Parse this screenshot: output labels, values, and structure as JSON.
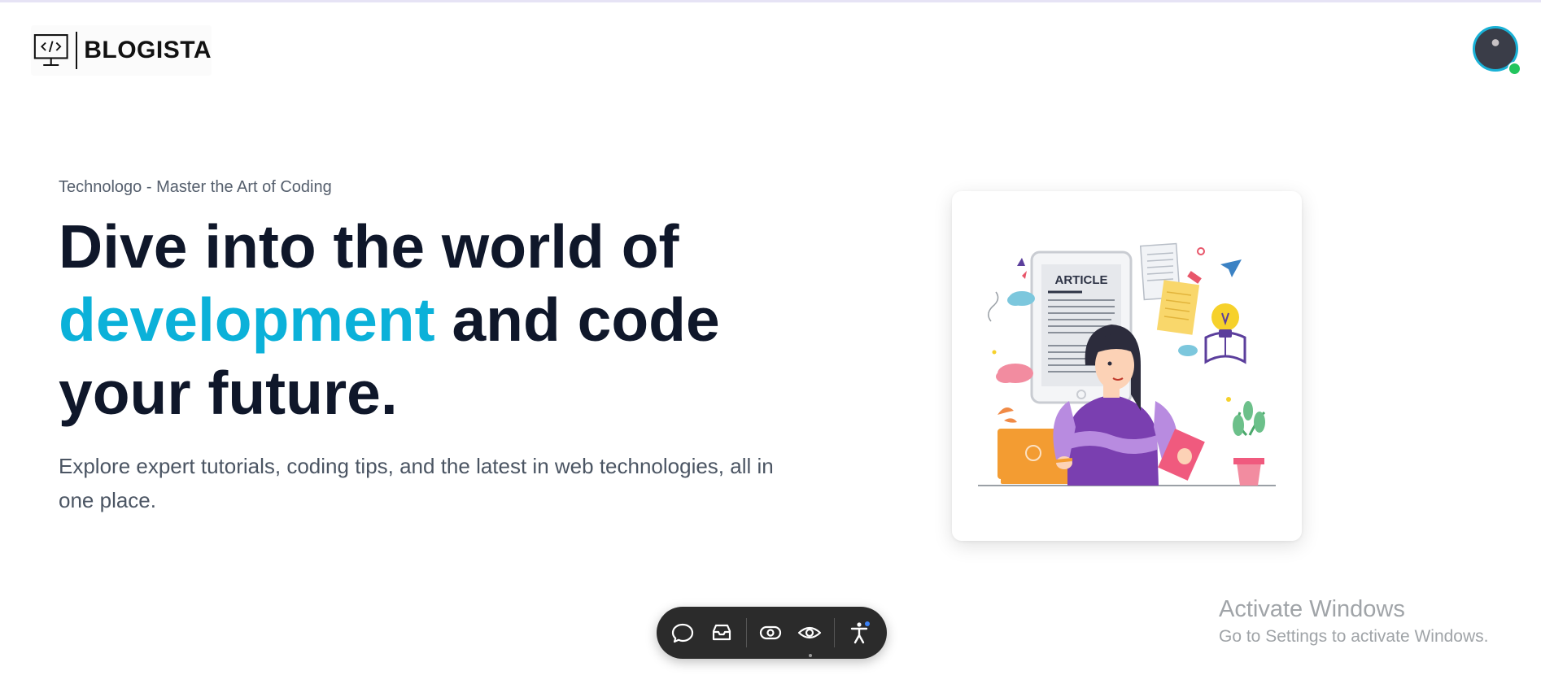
{
  "header": {
    "logo_text": "BLOGISTA",
    "logo_icon": "monitor-code-icon",
    "avatar": "user-avatar",
    "status_color": "#22c55e"
  },
  "hero": {
    "eyebrow": "Technologo - Master the Art of Coding",
    "headline_part1": "Dive into the world of",
    "headline_accent": "development",
    "headline_part2": "and code",
    "headline_part3": "your future.",
    "subtext": "Explore expert tutorials, coding tips, and the latest in web technologies, all in one place.",
    "accent_color": "#0bb1d9"
  },
  "illustration": {
    "article_label": "ARTICLE"
  },
  "toolbar": {
    "icons": [
      "comment-icon",
      "inbox-icon",
      "view-toggle-icon",
      "eye-icon",
      "accessibility-icon"
    ]
  },
  "watermark": {
    "title": "Activate Windows",
    "subtitle": "Go to Settings to activate Windows."
  }
}
